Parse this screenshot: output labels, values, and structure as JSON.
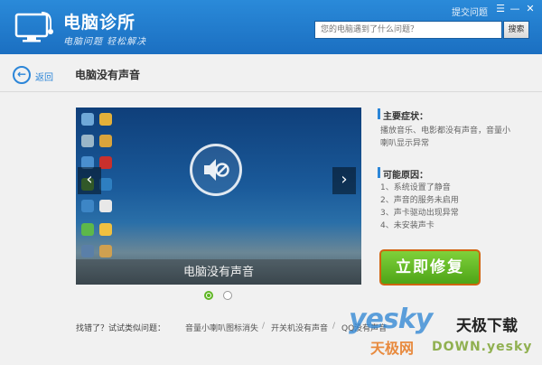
{
  "header": {
    "app_title": "电脑诊所",
    "slogan": "电脑问题  轻松解决",
    "feedback_link": "提交问题",
    "menu_glyph": "☰",
    "minimize_glyph": "—",
    "close_glyph": "✕",
    "search": {
      "placeholder": "您的电脑遇到了什么问题？",
      "button_label": "搜索"
    }
  },
  "nav": {
    "back_label": "返回",
    "back_glyph": "←",
    "page_title": "电脑没有声音"
  },
  "slide": {
    "caption": "电脑没有声音",
    "prev_glyph": "‹",
    "next_glyph": "›",
    "dots": 2,
    "active_dot": 1
  },
  "symptoms": {
    "heading": "主要症状：",
    "text": "播放音乐、电影都没有声音，音量小喇叭显示异常"
  },
  "causes": {
    "heading": "可能原因：",
    "items": [
      "1、系统设置了静音",
      "2、声音的服务未启用",
      "3、声卡驱动出现异常",
      "4、未安装声卡"
    ]
  },
  "fix_button_label": "立即修复",
  "similar": {
    "label": "找错了？试试类似问题：",
    "links": [
      "音量小喇叭图标消失",
      "开关机没有声音",
      "QQ没有声音"
    ],
    "separator": "/"
  },
  "watermark": {
    "brand": "yesky",
    "brand_cn": "天极下载",
    "site_cn": "天极网",
    "domain": "DOWN.yesky"
  },
  "colors": {
    "header": "#1b6fc1",
    "accent": "#2c86d8",
    "fix_button": "#5fb624",
    "fix_border": "#d06410"
  }
}
